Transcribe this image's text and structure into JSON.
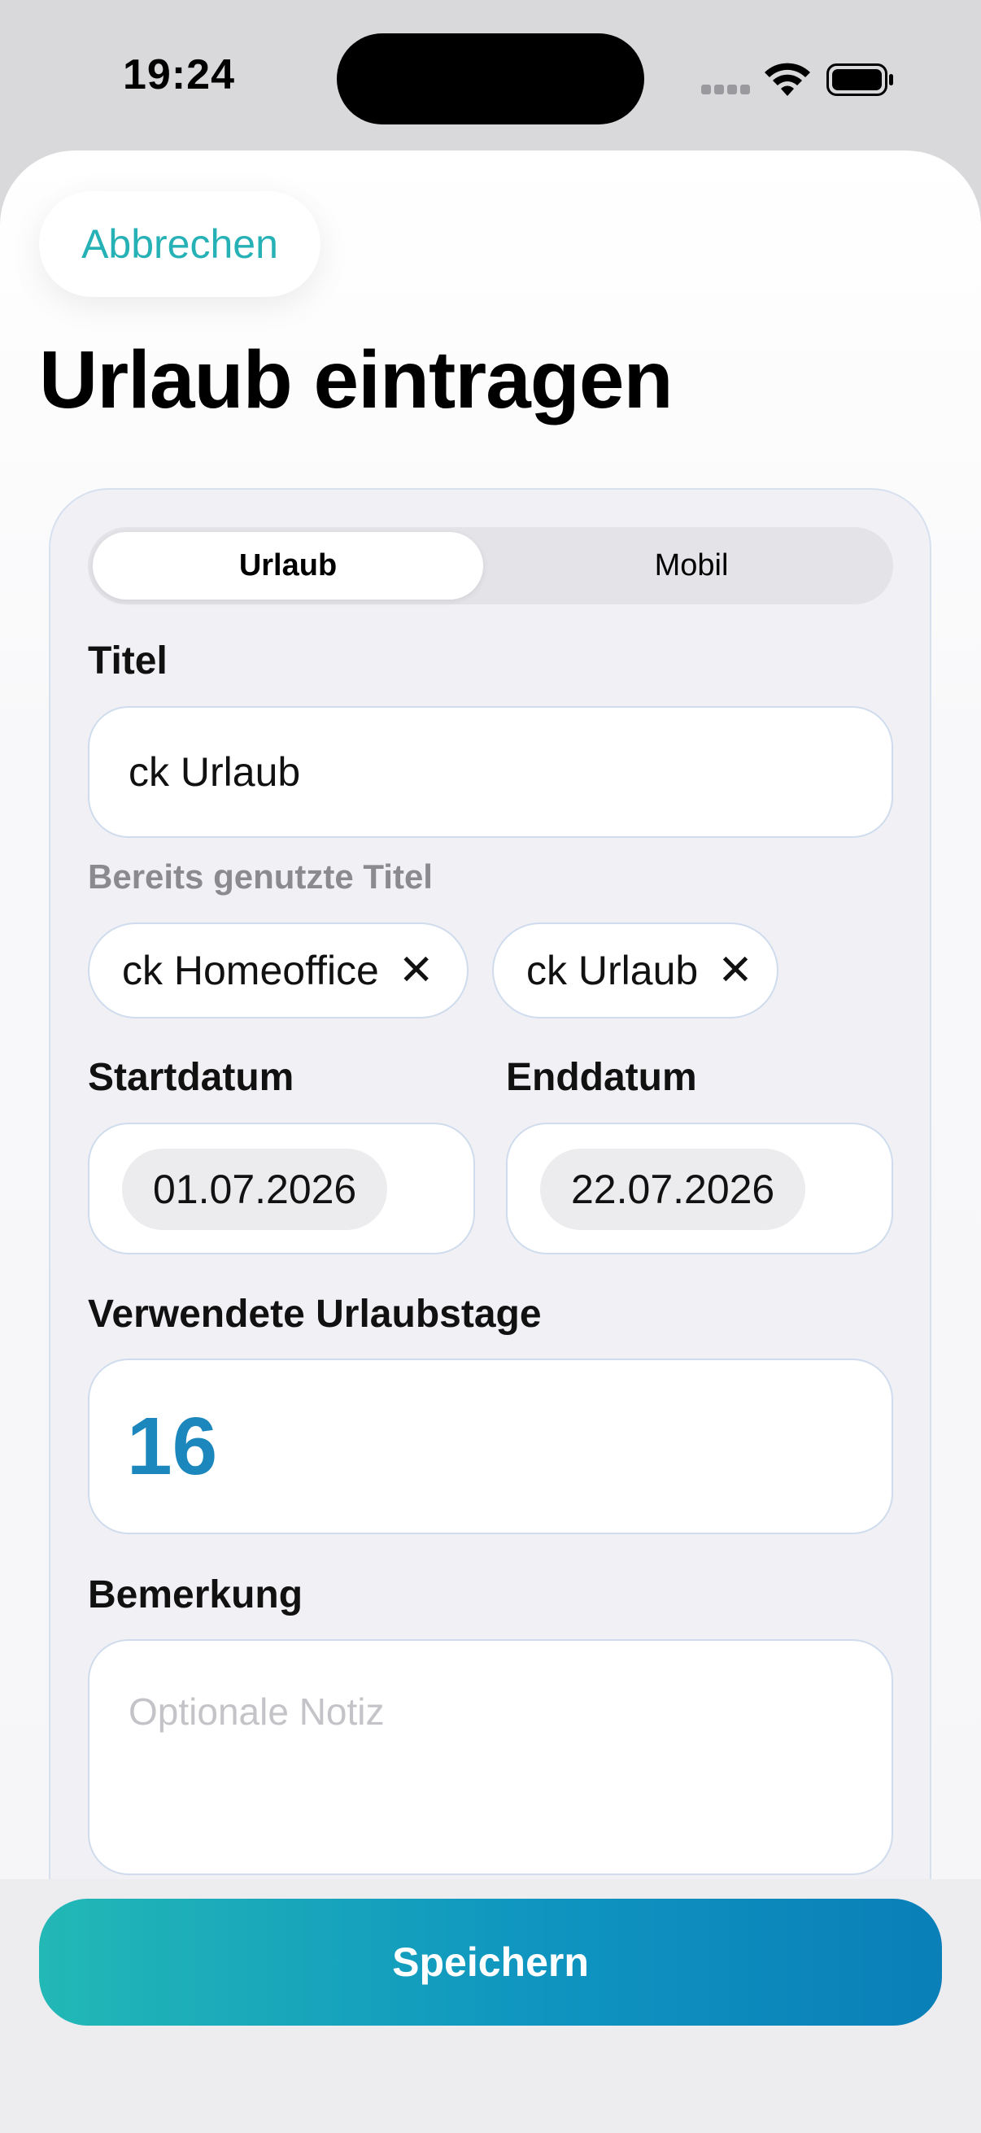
{
  "status_bar": {
    "time": "19:24",
    "icons": [
      "signal-icon",
      "wifi-icon",
      "battery-icon"
    ]
  },
  "header": {
    "cancel_label": "Abbrechen",
    "title": "Urlaub eintragen"
  },
  "segmented_control": {
    "options": [
      "Urlaub",
      "Mobil"
    ],
    "selected": "Urlaub"
  },
  "form": {
    "title_label": "Titel",
    "title_value": "ck Urlaub",
    "used_titles_hint": "Bereits genutzte Titel",
    "used_titles": [
      {
        "label": "ck Homeoffice",
        "remove_glyph": "✕"
      },
      {
        "label": "ck Urlaub",
        "remove_glyph": "✕"
      }
    ],
    "start_label": "Startdatum",
    "start_value": "01.07.2026",
    "end_label": "Enddatum",
    "end_value": "22.07.2026",
    "days_label": "Verwendete Urlaubstage",
    "days_value": "16",
    "note_label": "Bemerkung",
    "note_placeholder": "Optionale Notiz"
  },
  "footer": {
    "save_label": "Speichern"
  },
  "colors": {
    "accent_teal": "#25b1b5",
    "accent_blue": "#1b87bd",
    "save_gradient_start": "#22b8b6",
    "save_gradient_end": "#0a7fb8"
  }
}
